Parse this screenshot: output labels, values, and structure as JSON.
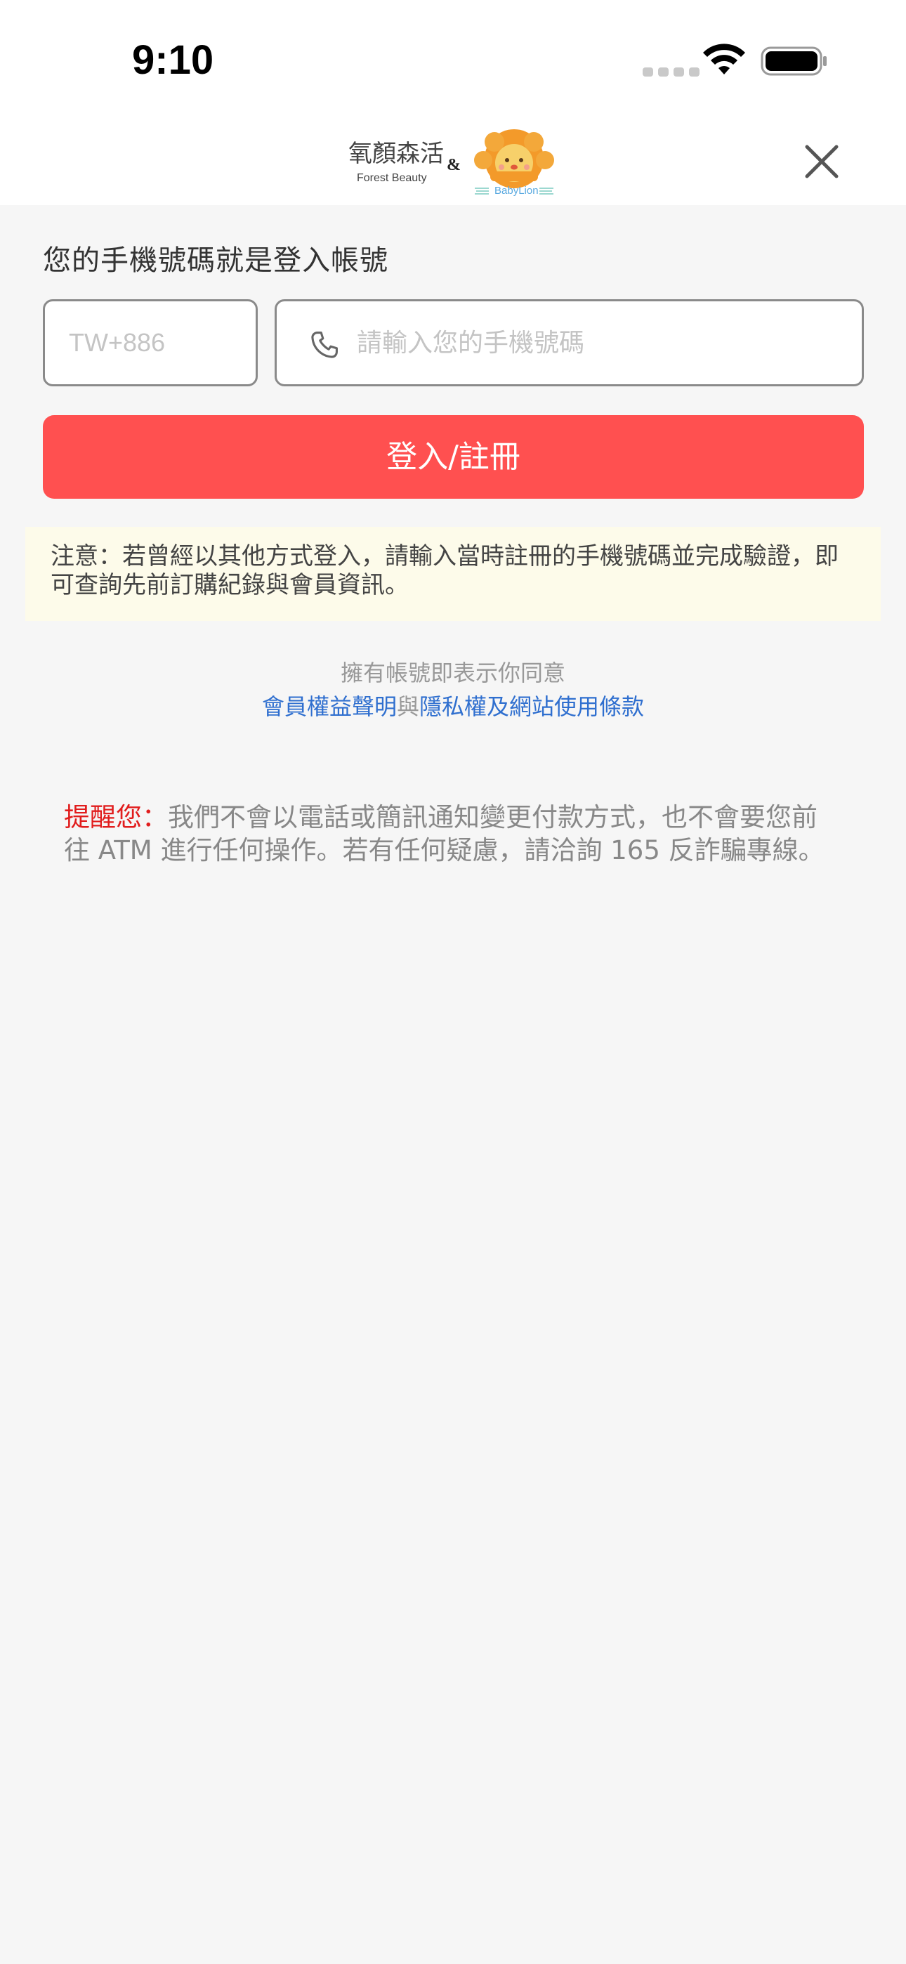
{
  "status_bar": {
    "time": "9:10"
  },
  "header": {
    "logo_brand_cn": "氧顏森活",
    "logo_brand_en": "Forest Beauty",
    "logo_ampersand": "&",
    "logo_partner": "BabyLion",
    "close_icon": "close-icon"
  },
  "login": {
    "title": "您的手機號碼就是登入帳號",
    "country_code": "TW+886",
    "phone_placeholder": "請輸入您的手機號碼",
    "submit_label": "登入/註冊"
  },
  "notice": {
    "text": "注意：若曾經以其他方式登入，請輸入當時註冊的手機號碼並完成驗證，即可查詢先前訂購紀錄與會員資訊。"
  },
  "terms": {
    "agree_text": "擁有帳號即表示你同意",
    "member_rights_link": "會員權益聲明",
    "conjunction": "與",
    "privacy_link": "隱私權及網站使用條款"
  },
  "reminder": {
    "label": "提醒您：",
    "text": "我們不會以電話或簡訊通知變更付款方式，也不會要您前往 ATM 進行任何操作。若有任何疑慮，請洽詢 165 反詐騙專線。"
  },
  "colors": {
    "primary_button": "#ff5050",
    "link": "#2f6fcf",
    "notice_bg": "#fdfbea",
    "reminder_label": "#e11d1d",
    "page_bg": "#f6f6f6"
  }
}
